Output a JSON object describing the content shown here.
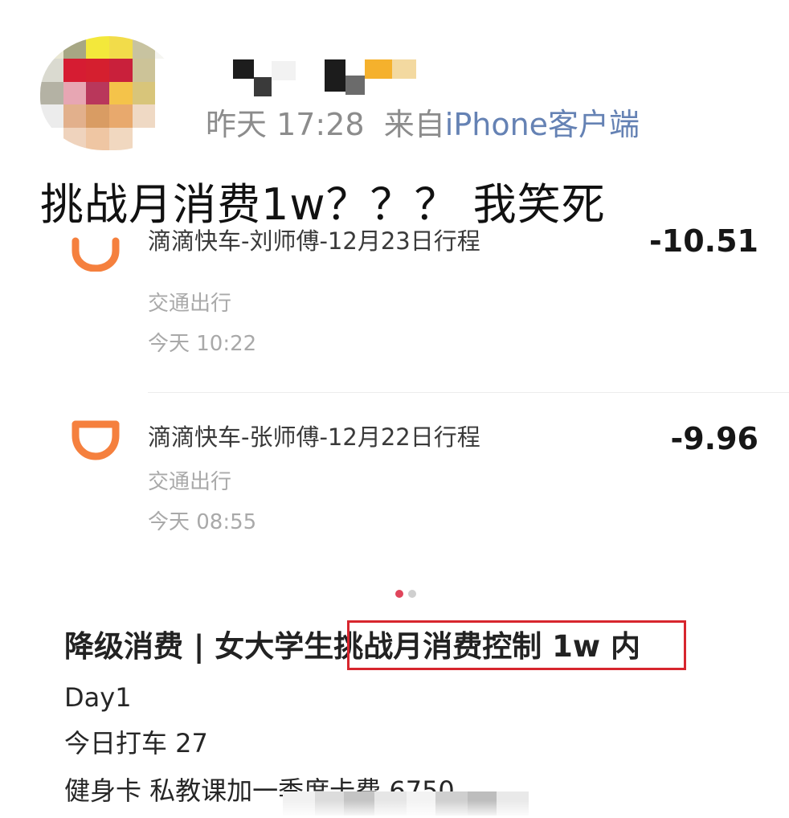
{
  "post": {
    "timestamp": "昨天 17:28",
    "source_prefix": "来自",
    "source_device": "iPhone客户端",
    "text": "挑战月消费1w？？？ 我笑死"
  },
  "transactions": [
    {
      "icon": "didi-icon",
      "title": "滴滴快车-刘师傅-12月23日行程",
      "category": "交通出行",
      "time": "今天 10:22",
      "amount": "-10.51"
    },
    {
      "icon": "didi-icon",
      "title": "滴滴快车-张师傅-12月22日行程",
      "category": "交通出行",
      "time": "今天 08:55",
      "amount": "-9.96"
    }
  ],
  "pager": {
    "active_color": "#e0455b",
    "inactive_color": "#cfcfcf"
  },
  "article": {
    "title_prefix": "降级消费 | 女大学生",
    "title_highlight": "挑战月消费控制 1w 内",
    "lines": [
      "Day1",
      "今日打车 27",
      "健身卡 私教课加一季度卡费 6750"
    ]
  },
  "colors": {
    "didi_orange": "#f5803e",
    "highlight_red": "#d7262e",
    "source_blue": "#6582b4"
  }
}
